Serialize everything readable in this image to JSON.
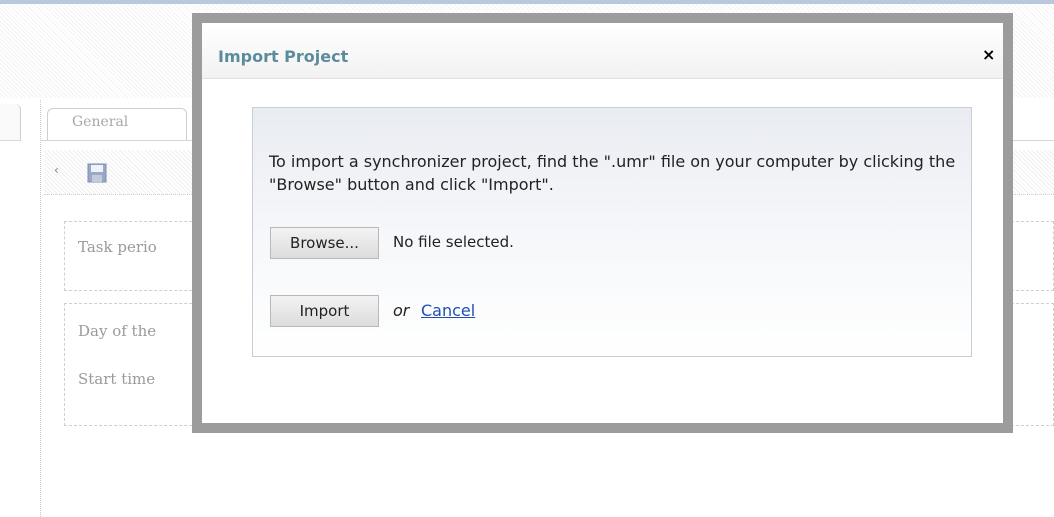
{
  "background": {
    "tab_general_label": "General",
    "label_task_period": "Task perio",
    "label_day_of_the": "Day of the",
    "label_start_time": "Start time"
  },
  "dialog": {
    "title": "Import Project",
    "close_glyph": "×",
    "instruction": "To import a synchronizer project, find the \".umr\" file on your computer by clicking the \"Browse\" button and click \"Import\".",
    "browse_label": "Browse...",
    "file_status": "No file selected.",
    "import_label": "Import",
    "or_text": "or",
    "cancel_label": "Cancel"
  },
  "colors": {
    "title_color": "#5b8c9e",
    "link_color": "#1f4fb3",
    "modal_frame": "#9c9c9c"
  },
  "icons": {
    "save": "floppy-disk-icon",
    "collapse": "chevron-left-icon"
  }
}
